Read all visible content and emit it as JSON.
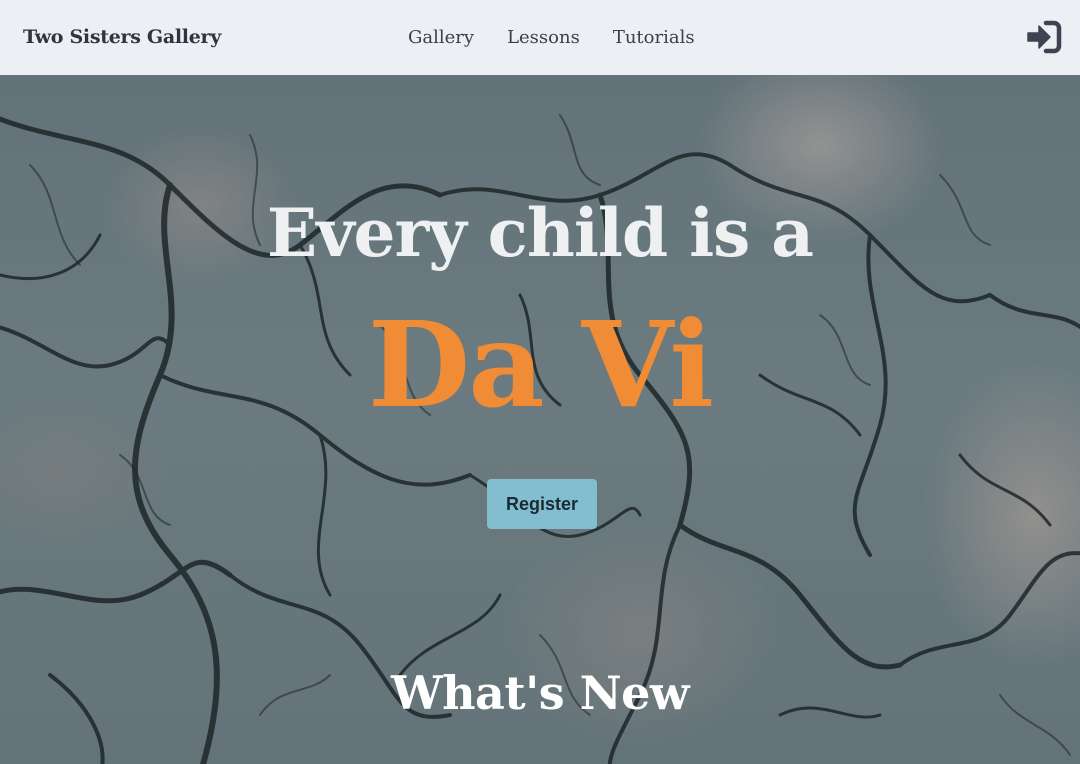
{
  "header": {
    "brand": "Two Sisters Gallery",
    "nav": [
      {
        "label": "Gallery"
      },
      {
        "label": "Lessons"
      },
      {
        "label": "Tutorials"
      }
    ],
    "login_icon": "sign-in-icon"
  },
  "hero": {
    "headline": "Every child is a",
    "highlight": "Da Vi",
    "register_label": "Register",
    "background": "blossom-branches-photo"
  },
  "whats_new": {
    "title": "What's New"
  },
  "colors": {
    "header_bg": "#eceff3",
    "brand_text": "#2f3440",
    "highlight": "#f08c35",
    "button_bg": "#82bdd0",
    "button_text": "#1b2a33",
    "hero_text": "#eef0f2"
  }
}
